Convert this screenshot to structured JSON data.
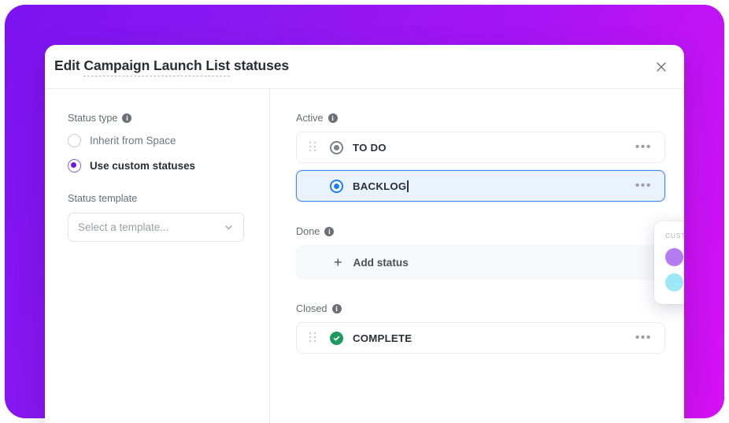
{
  "backdrop": {
    "gradient_from": "#7b13f0",
    "gradient_to": "#d511f2"
  },
  "modal": {
    "title_prefix": "Edit ",
    "title_dashed": "Campaign Launch List",
    "title_suffix": " statuses",
    "close_icon": "close-icon"
  },
  "left_pane": {
    "status_type_label": "Status type",
    "info_glyph": "i",
    "options": [
      {
        "label": "Inherit from Space",
        "selected": false
      },
      {
        "label": "Use custom statuses",
        "selected": true
      }
    ],
    "status_template_label": "Status template",
    "template_placeholder": "Select a template...",
    "chevron_icon": "chevron-down-icon"
  },
  "right_pane": {
    "sections": [
      {
        "key": "active",
        "label": "Active"
      },
      {
        "key": "done",
        "label": "Done"
      },
      {
        "key": "closed",
        "label": "Closed"
      }
    ],
    "active_statuses": [
      {
        "name": "TO DO",
        "color": "#7c828c",
        "type": "ring",
        "focused": false
      },
      {
        "name": "BACKLOG",
        "color": "#1f7ef5",
        "type": "ring",
        "focused": true
      }
    ],
    "closed_statuses": [
      {
        "name": "COMPLETE",
        "color": "#1d9b5e",
        "type": "check",
        "focused": false
      }
    ],
    "add_status_label": "Add status",
    "add_status_plus": "+",
    "row_menu_glyph": "•••",
    "drag_handle_icon": "drag-handle-icon",
    "more-menu-icon": "more-horizontal-icon"
  },
  "color_popover": {
    "title": "CUSTOMIZE COLOR",
    "close_icon": "close-icon",
    "eyedropper_icon": "eyedropper-icon",
    "cursor_icon": "cursor-pointer-icon",
    "swatches_row1": [
      {
        "name": "purple",
        "hex": "#b57bf0",
        "selected": false
      },
      {
        "name": "blue",
        "hex": "#7aa8f2",
        "selected": false
      },
      {
        "name": "red",
        "hex": "#f43b4e",
        "selected": true
      },
      {
        "name": "pink",
        "hex": "#fb64d6",
        "selected": false
      },
      {
        "name": "yellow",
        "hex": "#fbdc6a",
        "selected": false
      },
      {
        "name": "orange",
        "hex": "#fba07a",
        "selected": false
      }
    ],
    "swatches_row2": [
      {
        "name": "cyan",
        "hex": "#9de8f7",
        "selected": false
      },
      {
        "name": "green",
        "hex": "#86dd91",
        "selected": false
      }
    ]
  }
}
